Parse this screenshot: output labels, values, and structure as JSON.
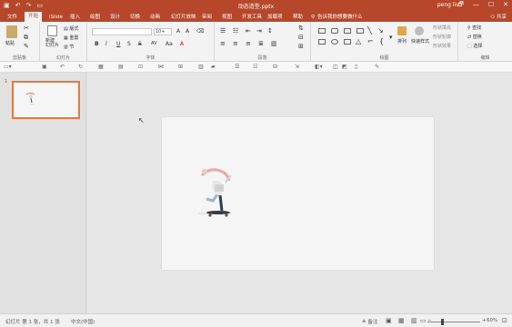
{
  "window": {
    "title": "动态造型.pptx",
    "user": "peng liu",
    "controls": [
      "🗗",
      "—",
      "☐",
      "✕"
    ]
  },
  "qat": {
    "save_icon": "save-icon",
    "undo_icon": "undo-icon",
    "redo_icon": "redo-icon",
    "present_icon": "present-icon"
  },
  "tabs": [
    {
      "label": "文件"
    },
    {
      "label": "开始"
    },
    {
      "label": "iSlide"
    },
    {
      "label": "插入"
    },
    {
      "label": "绘图"
    },
    {
      "label": "设计"
    },
    {
      "label": "切换"
    },
    {
      "label": "动画"
    },
    {
      "label": "幻灯片放映"
    },
    {
      "label": "审阅"
    },
    {
      "label": "视图"
    },
    {
      "label": "开发工具"
    },
    {
      "label": "加载项"
    },
    {
      "label": "帮助"
    }
  ],
  "tellme": "告诉我你想要做什么",
  "share": "共享",
  "ribbon": {
    "clipboard": {
      "label": "剪贴板",
      "paste": "粘贴"
    },
    "slides": {
      "label": "幻灯片",
      "new_slide": "新建\n幻灯片",
      "layout": "版式",
      "reset": "重置",
      "section": "节"
    },
    "font": {
      "label": "字体",
      "font_name": "",
      "font_size": "10+",
      "bold": "B",
      "italic": "I",
      "underline": "U",
      "strike": "S",
      "shadow": "S",
      "spacing": "AV",
      "case": "Aa",
      "color": "A"
    },
    "paragraph": {
      "label": "段落"
    },
    "drawing": {
      "label": "绘图",
      "arrange": "排列",
      "quick_styles": "快速样式",
      "fill": "形状填充",
      "outline": "形状轮廓",
      "effects": "形状效果"
    },
    "editing": {
      "label": "编辑",
      "find": "查找",
      "replace": "替换",
      "select": "选择"
    }
  },
  "slides_pane": {
    "slide_number": "1"
  },
  "status": {
    "slide_info": "幻灯片 第 1 张，共 1 张",
    "language": "中文(中国)",
    "notes": "备注",
    "zoom": "60%",
    "zoom_fraction": 0.6
  }
}
